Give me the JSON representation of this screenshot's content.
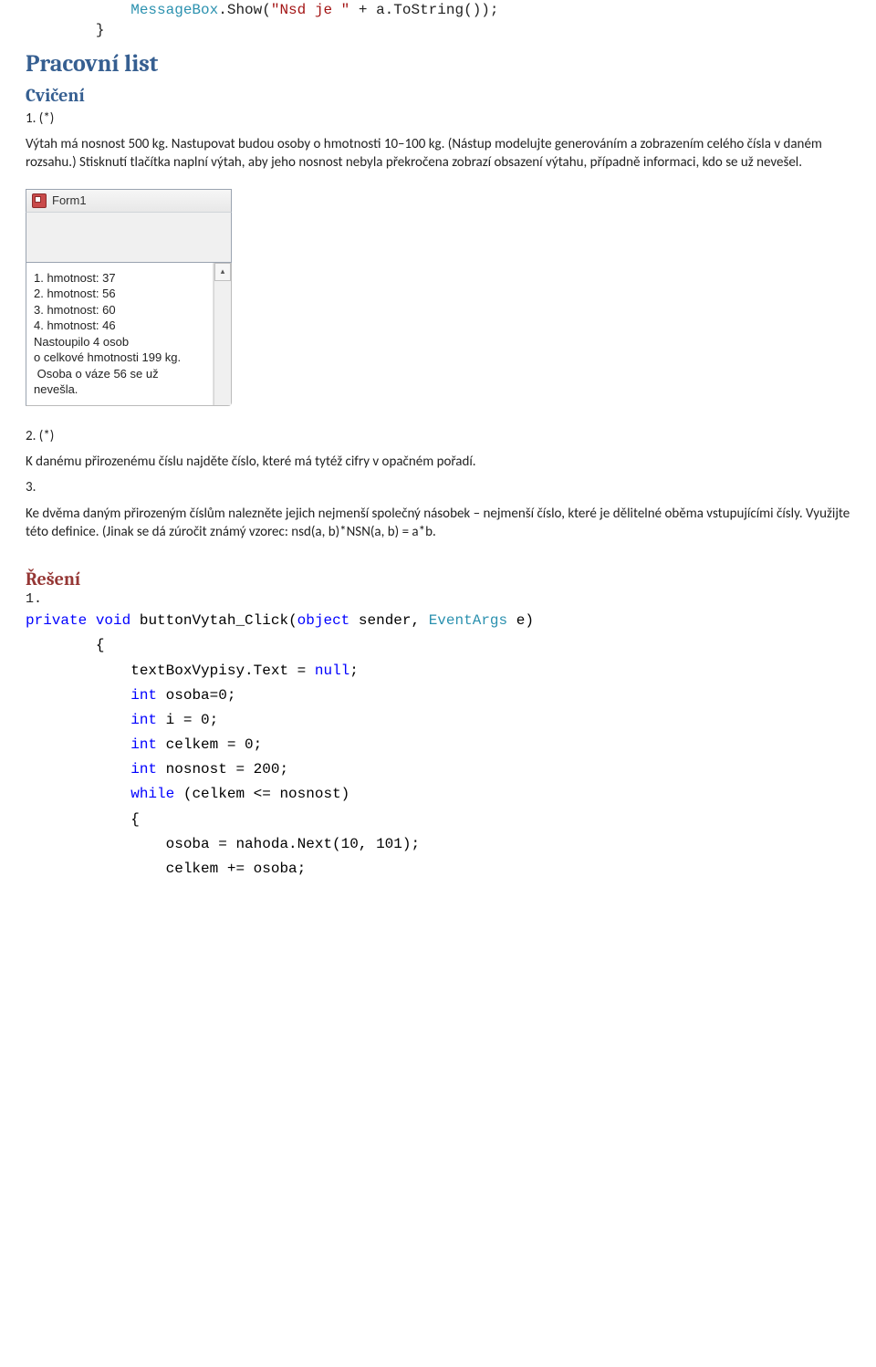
{
  "topcode": {
    "text_prefix": "            MessageBox.Show(",
    "msgbox_type": "MessageBox",
    "string_literal": "\"Nsd je \"",
    "text_suffix": " + a.ToString());",
    "closing_brace": "        }"
  },
  "h_pracovni": "Pracovní list",
  "h_cviceni": "Cvičení",
  "ex1_num": "1. (*)",
  "ex1_p1": "Výtah má nosnost 500 kg. Nastupovat budou osoby o hmotnosti 10–100 kg. (Nástup modelujte generováním a zobrazením celého čísla v daném rozsahu.) Stisknutí tlačítka naplní výtah, aby jeho nosnost nebyla překročena zobrazí obsazení výtahu, případně informaci, kdo se už nevešel.",
  "form": {
    "title": "Form1",
    "textbox": "1. hmotnost: 37\n2. hmotnost: 56\n3. hmotnost: 60\n4. hmotnost: 46\nNastoupilo 4 osob\no celkové hmotnosti 199 kg.\n Osoba o váze 56 se už\nnevešla."
  },
  "ex2_num": "2. (*)",
  "ex2_p": "K danému přirozenému číslu najděte číslo, které má tytéž cifry v opačném pořadí.",
  "ex3_num": "3.",
  "ex3_p": "Ke dvěma daným přirozeným číslům nalezněte jejich nejmenší společný násobek – nejmenší číslo, které je dělitelné oběma vstupujícími čísly. Využijte této definice. (Jinak se dá zúročit známý vzorec: nsd(a, b)*NSN(a, b) = a*b.",
  "h_reseni": "Řešení",
  "reseni_num": "1.",
  "code": {
    "l1_private": "private",
    "l1_void": "void",
    "l1_name": " buttonVytah_Click(",
    "l1_object": "object",
    "l1_sender": " sender, ",
    "l1_ea": "EventArgs",
    "l1_e": " e)",
    "l2": "        {",
    "l3_a": "            textBoxVypisy.Text = ",
    "l3_null": "null",
    "l3_b": ";",
    "l4_int": "int",
    "l4_rest": " osoba=0;",
    "l5_int": "int",
    "l5_rest": " i = 0;",
    "l6_int": "int",
    "l6_rest": " celkem = 0;",
    "l7_int": "int",
    "l7_rest": " nosnost = 200;",
    "l8_while": "while",
    "l8_rest": " (celkem <= nosnost)",
    "l9": "            {",
    "l10": "                osoba = nahoda.Next(10, 101);",
    "l11": "                celkem += osoba;"
  }
}
